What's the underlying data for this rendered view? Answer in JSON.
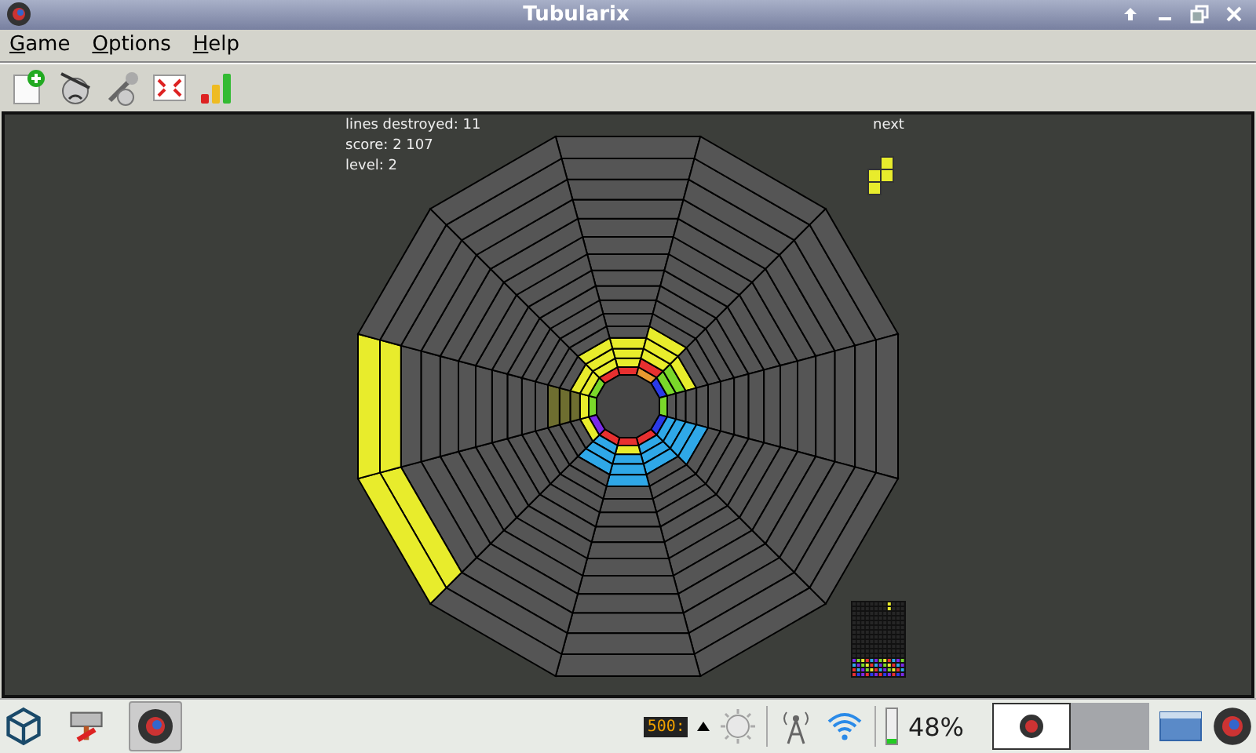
{
  "window": {
    "title": "Tubularix"
  },
  "menu": [
    {
      "label": "Game"
    },
    {
      "label": "Options"
    },
    {
      "label": "Help"
    }
  ],
  "stats": [
    "lines destroyed: 11",
    "score: 2 107",
    "level: 2"
  ],
  "next_label": "next",
  "taskbar": {
    "display": "500:",
    "battery": {
      "level": 0.12,
      "reading": "48%"
    }
  }
}
